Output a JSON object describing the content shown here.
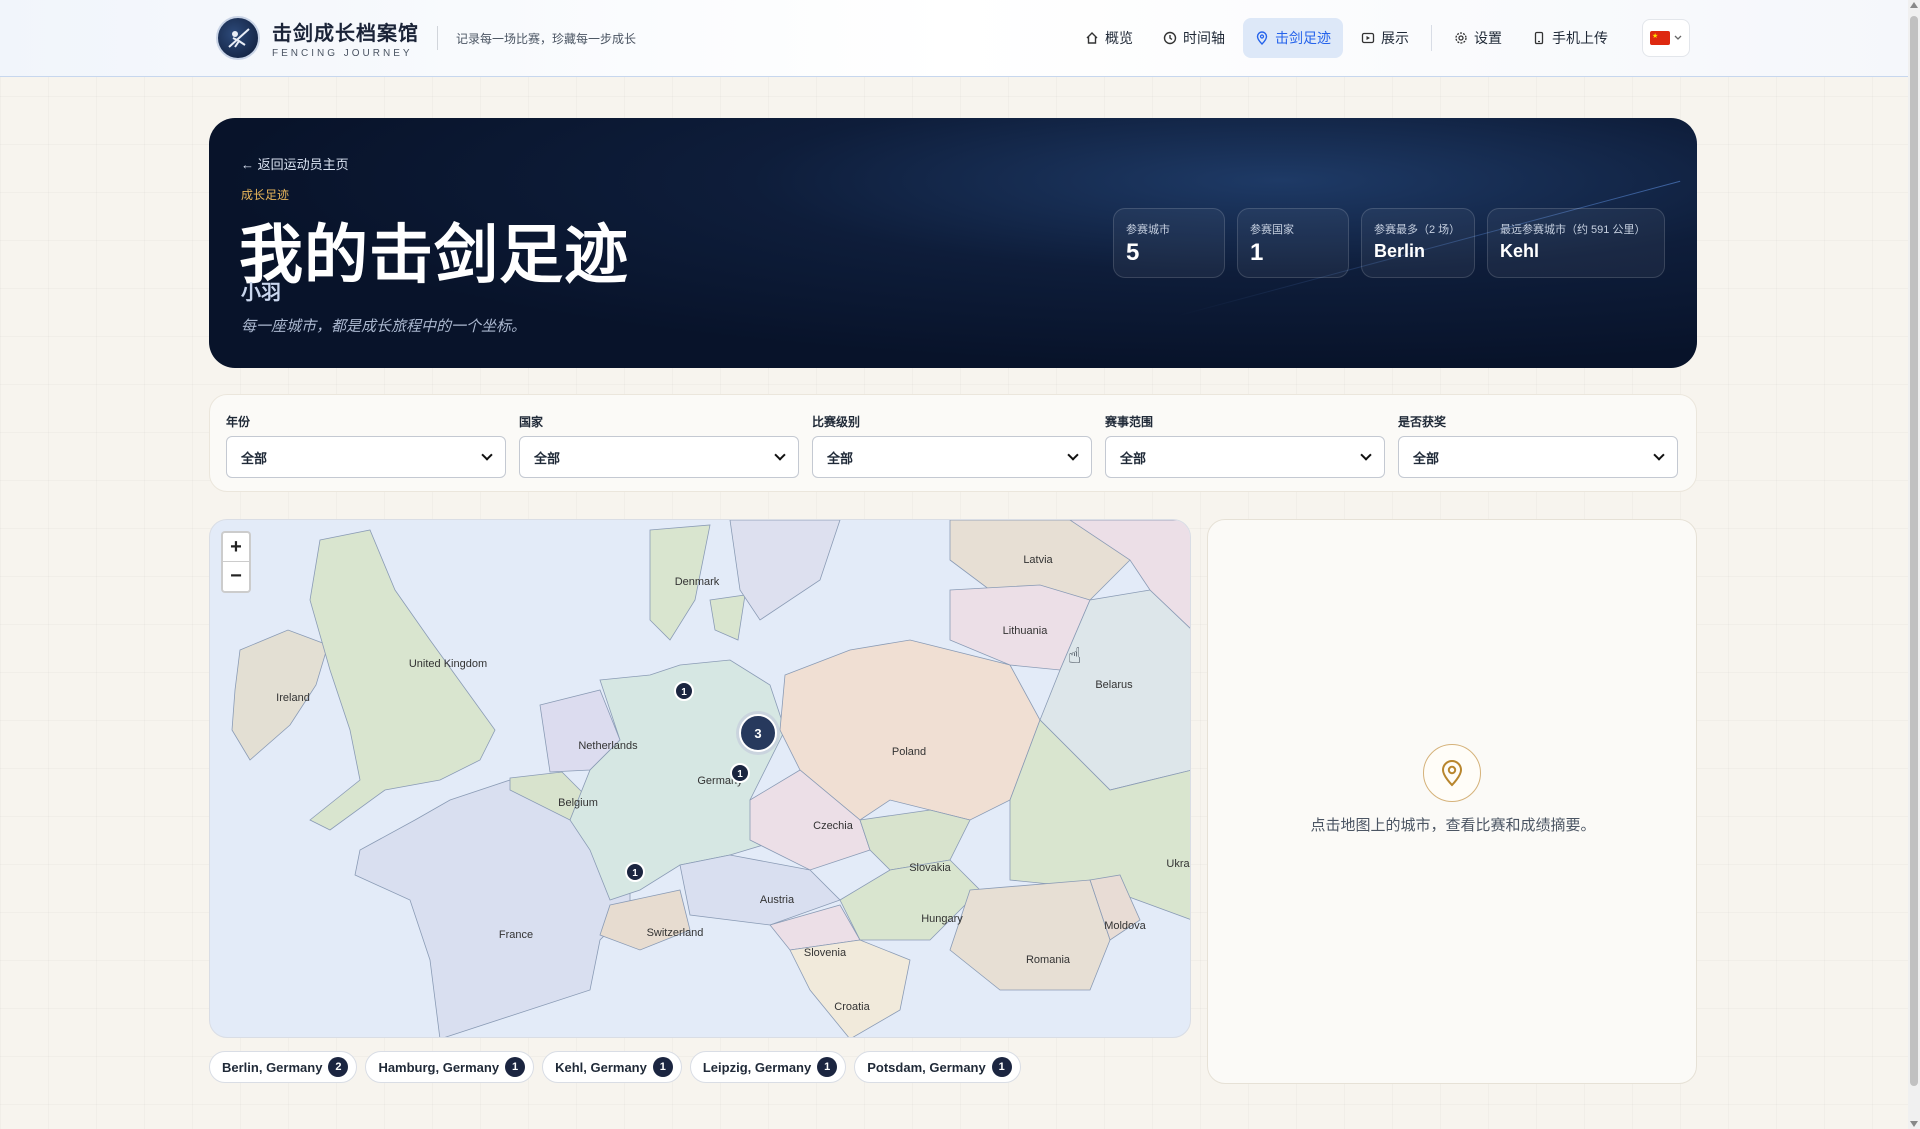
{
  "header": {
    "brand_title": "击剑成长档案馆",
    "brand_subtitle": "FENCING JOURNEY",
    "slogan": "记录每一场比赛，珍藏每一步成长",
    "nav": [
      {
        "label": "概览",
        "icon": "home-icon"
      },
      {
        "label": "时间轴",
        "icon": "clock-icon"
      },
      {
        "label": "击剑足迹",
        "icon": "map-pin-icon",
        "active": true
      },
      {
        "label": "展示",
        "icon": "play-icon"
      },
      {
        "label": "设置",
        "icon": "gear-icon"
      },
      {
        "label": "手机上传",
        "icon": "phone-icon"
      }
    ],
    "language_flag": "china-flag-icon"
  },
  "hero": {
    "back_link": "← 返回运动员主页",
    "eyebrow": "成长足迹",
    "title": "我的击剑足迹",
    "athlete_name": "小羽",
    "description": "每一座城市，都是成长旅程中的一个坐标。",
    "stats": [
      {
        "label": "参赛城市",
        "value": "5"
      },
      {
        "label": "参赛国家",
        "value": "1"
      },
      {
        "label": "参赛最多（2 场）",
        "value": "Berlin"
      },
      {
        "label": "最远参赛城市（约 591 公里）",
        "value": "Kehl"
      }
    ]
  },
  "filters": [
    {
      "label": "年份",
      "value": "全部"
    },
    {
      "label": "国家",
      "value": "全部"
    },
    {
      "label": "比赛级别",
      "value": "全部"
    },
    {
      "label": "赛事范围",
      "value": "全部"
    },
    {
      "label": "是否获奖",
      "value": "全部"
    }
  ],
  "map": {
    "zoom_in": "+",
    "zoom_out": "−",
    "country_labels": {
      "latvia": "Latvia",
      "denmark": "Denmark",
      "lithuania": "Lithuania",
      "united_kingdom": "United Kingdom",
      "ireland": "Ireland",
      "belarus": "Belarus",
      "netherlands": "Netherlands",
      "poland": "Poland",
      "germany": "Germany",
      "belgium": "Belgium",
      "czechia": "Czechia",
      "ukraine": "Ukra",
      "slovakia": "Slovakia",
      "austria": "Austria",
      "hungary": "Hungary",
      "moldova": "Moldova",
      "france": "France",
      "switzerland": "Switzerland",
      "slovenia": "Slovenia",
      "romania": "Romania",
      "croatia": "Croatia"
    },
    "markers": {
      "hamburg": "1",
      "berlin_cluster": "3",
      "leipzig": "1",
      "kehl": "1"
    }
  },
  "side_panel": {
    "hint": "点击地图上的城市，查看比赛和成绩摘要。"
  },
  "cities": [
    {
      "name": "Berlin, Germany",
      "count": "2"
    },
    {
      "name": "Hamburg, Germany",
      "count": "1"
    },
    {
      "name": "Kehl, Germany",
      "count": "1"
    },
    {
      "name": "Leipzig, Germany",
      "count": "1"
    },
    {
      "name": "Potsdam, Germany",
      "count": "1"
    }
  ]
}
